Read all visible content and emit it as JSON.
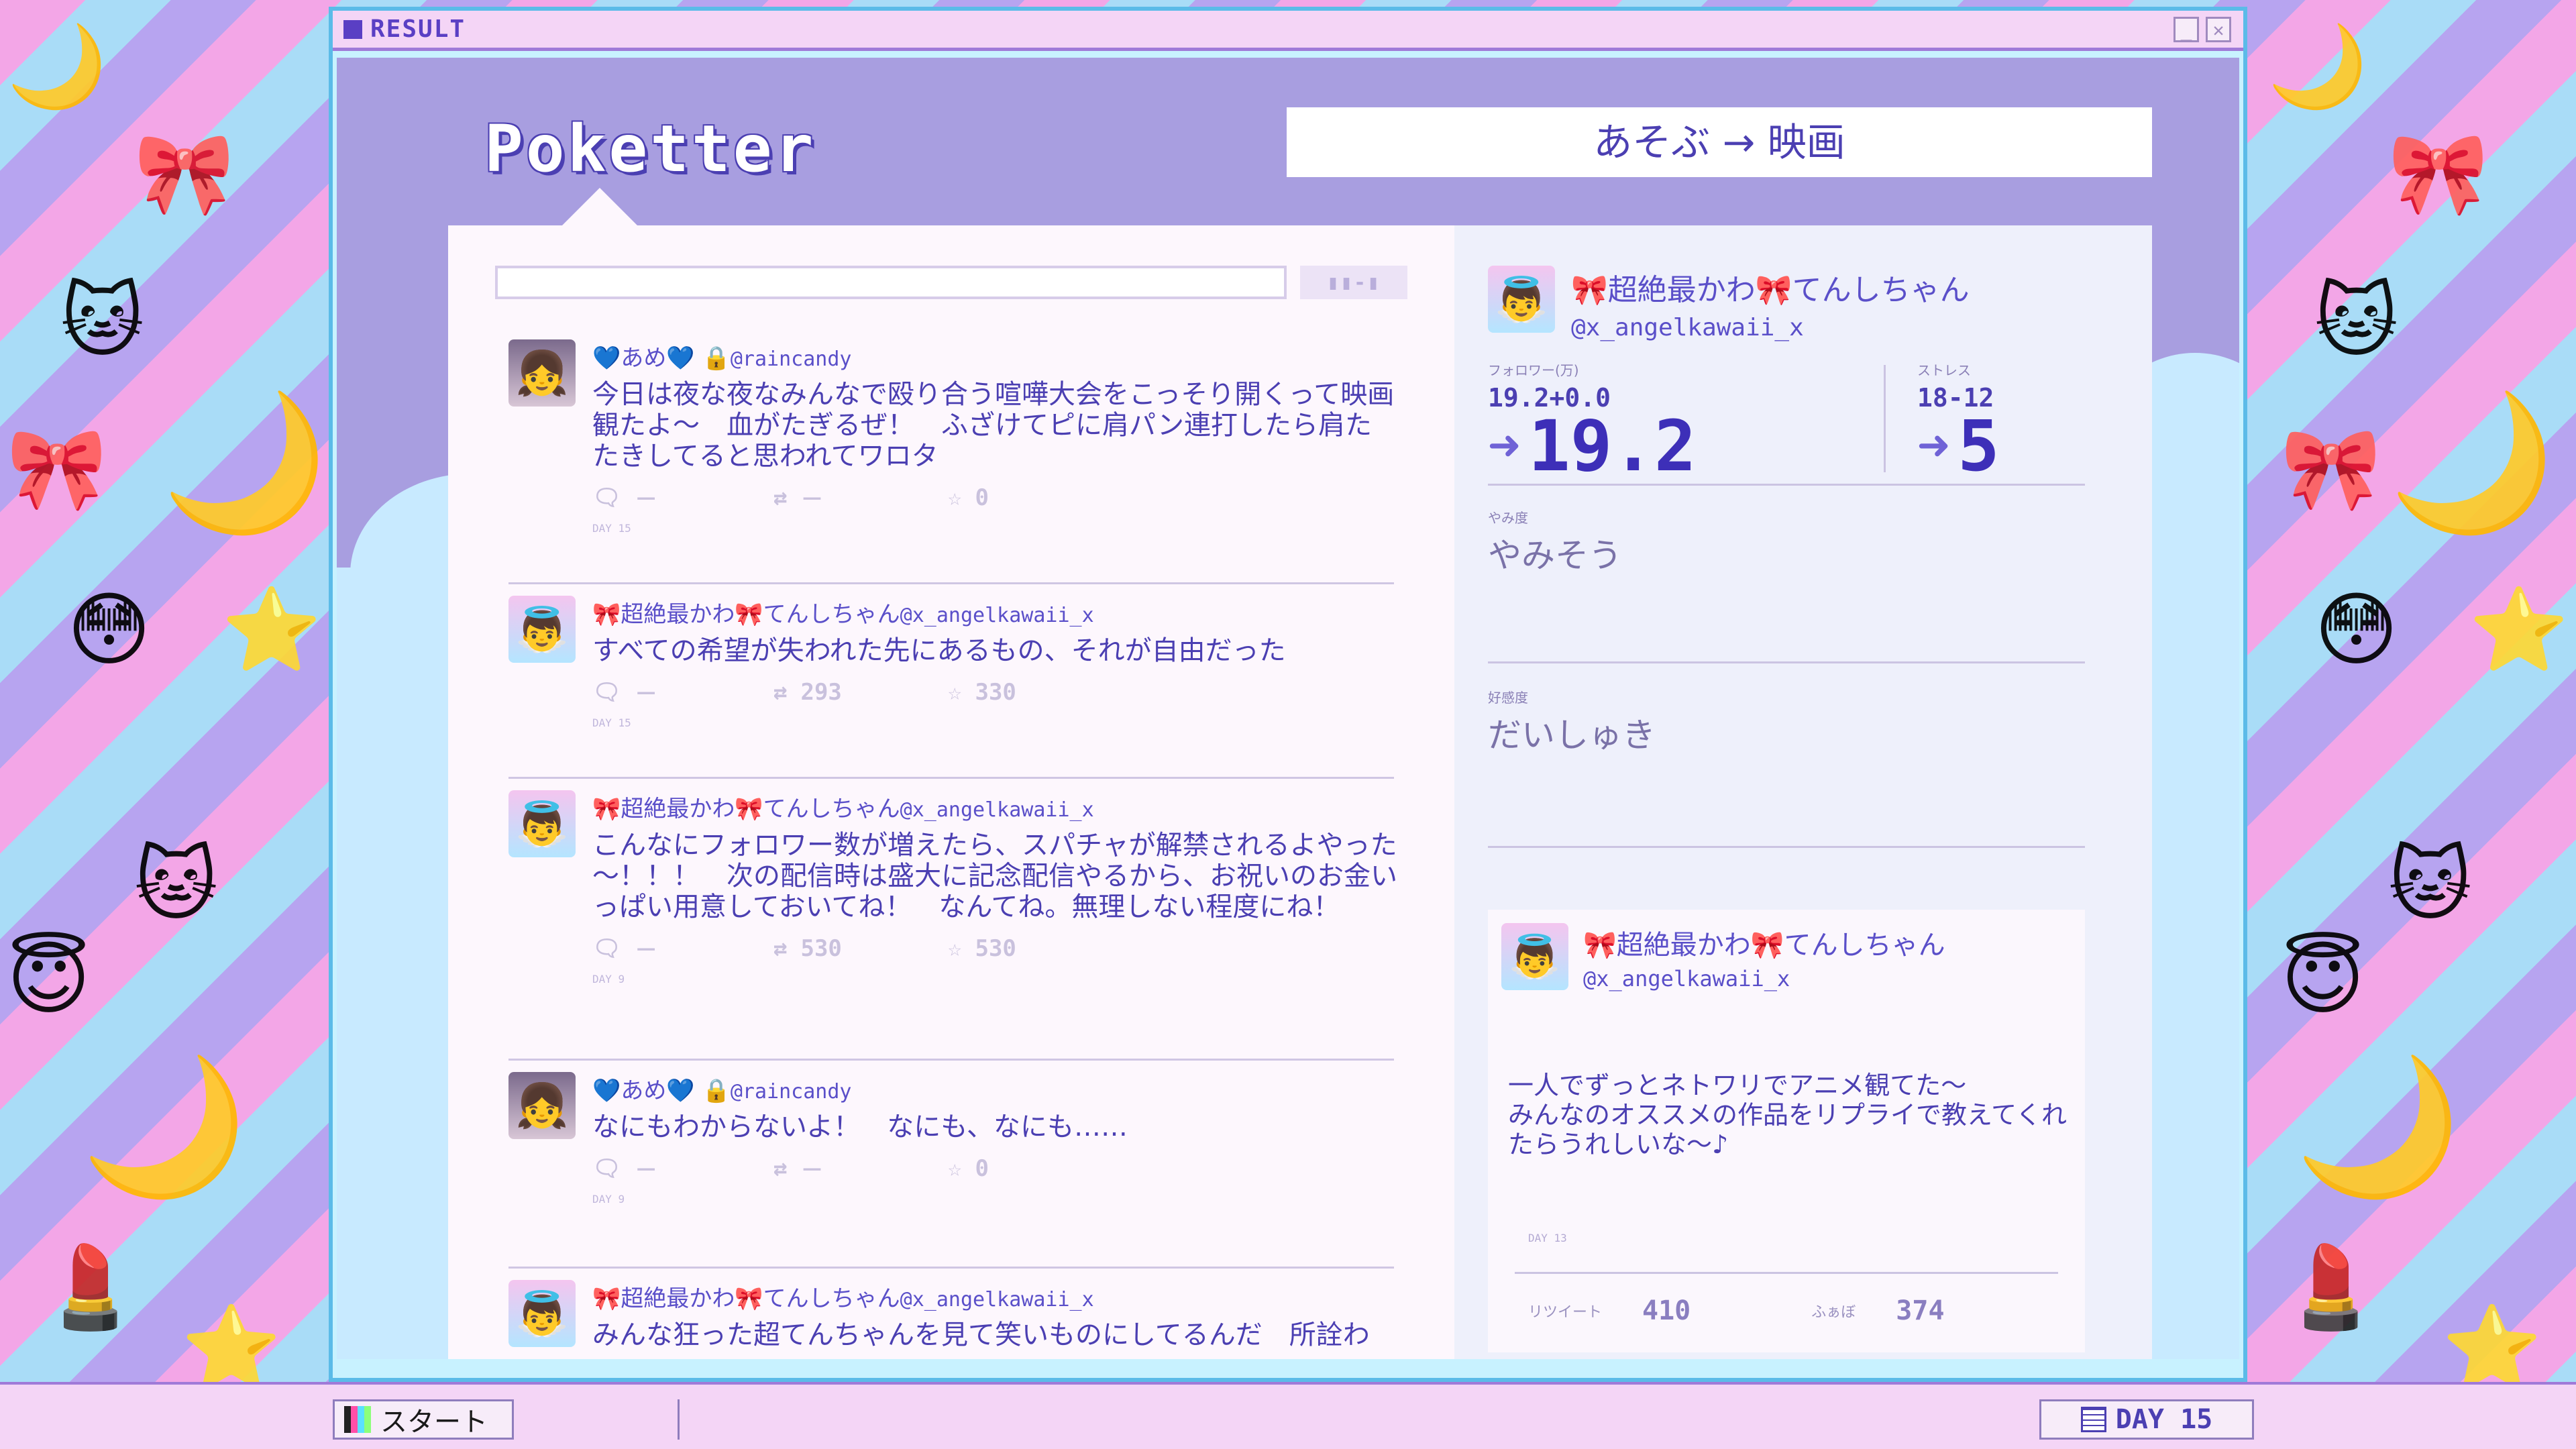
{
  "window": {
    "title": "RESULT",
    "minimize_label": "_",
    "close_label": "✕"
  },
  "app": {
    "logo": "Poketter",
    "breadcrumb": "あそぶ → 映画"
  },
  "search": {
    "value": "",
    "placeholder": "",
    "button_label": "▮▮-▮"
  },
  "feed": {
    "tweets": [
      {
        "name": "💙あめ💙",
        "lock": "🔒",
        "handle": "@raincandy",
        "text": "今日は夜な夜なみんなで殴り合う喧嘩大会をこっそり開くって映画観たよ～　血がたぎるぜ！　ふざけてピに肩パン連打したら肩たたきしてると思われてワロタ",
        "reply_count": "－",
        "retweet_count": "－",
        "like_count": "0",
        "day": "DAY 15"
      },
      {
        "name": "🎀超絶最かわ🎀てんしちゃん",
        "lock": "",
        "handle": "@x_angelkawaii_x",
        "text": "すべての希望が失われた先にあるもの、それが自由だった",
        "reply_count": "－",
        "retweet_count": "293",
        "like_count": "330",
        "day": "DAY 15"
      },
      {
        "name": "🎀超絶最かわ🎀てんしちゃん",
        "lock": "",
        "handle": "@x_angelkawaii_x",
        "text": "こんなにフォロワー数が増えたら、スパチャが解禁されるよやった～！！！　次の配信時は盛大に記念配信やるから、お祝いのお金いっぱい用意しておいてね！　なんてね。無理しない程度にね！",
        "reply_count": "－",
        "retweet_count": "530",
        "like_count": "530",
        "day": "DAY 9"
      },
      {
        "name": "💙あめ💙",
        "lock": "🔒",
        "handle": "@raincandy",
        "text": "なにもわからないよ！　なにも、なにも……",
        "reply_count": "－",
        "retweet_count": "－",
        "like_count": "0",
        "day": "DAY 9"
      },
      {
        "name": "🎀超絶最かわ🎀てんしちゃん",
        "lock": "",
        "handle": "@x_angelkawaii_x",
        "text": "みんな狂った超てんちゃんを見て笑いものにしてるんだ　所詮わ",
        "reply_count": "",
        "retweet_count": "",
        "like_count": "",
        "day": ""
      }
    ]
  },
  "profile": {
    "name": "🎀超絶最かわ🎀てんしちゃん",
    "handle": "@x_angelkawaii_x",
    "followers_label": "フォロワー(万)",
    "followers_delta": "19.2+0.0",
    "followers_value": "19.2",
    "stress_label": "ストレス",
    "stress_delta": "18-12",
    "stress_value": "5",
    "yami_label": "やみ度",
    "yami_value": "やみそう",
    "affection_label": "好感度",
    "affection_value": "だいしゅき"
  },
  "featured": {
    "name": "🎀超絶最かわ🎀てんしちゃん",
    "handle": "@x_angelkawaii_x",
    "text": "一人でずっとネトワリでアニメ観てた～\nみんなのオススメの作品をリプライで教えてくれたらうれしいな～♪",
    "day": "DAY 13",
    "retweet_label": "リツイート",
    "retweet_count": "410",
    "like_label": "ふぁぼ",
    "like_count": "374"
  },
  "taskbar": {
    "start_label": "スタート",
    "day_label": "DAY 15"
  },
  "colors": {
    "accent": "#4b3fb2",
    "panel": "#a89ee0",
    "feed_bg": "#fdf7fd",
    "sidebar_bg": "#eef0fb"
  }
}
